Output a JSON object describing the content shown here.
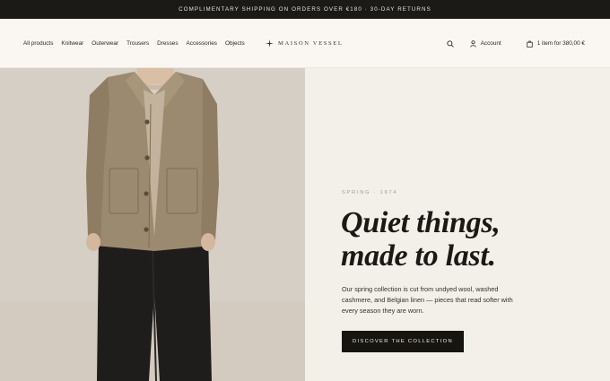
{
  "announcement": "COMPLIMENTARY SHIPPING ON ORDERS OVER €180 · 30-DAY RETURNS",
  "nav": [
    "All products",
    "Knitwear",
    "Outerwear",
    "Trousers",
    "Dresses",
    "Accessories",
    "Objects"
  ],
  "brand": "MAISON VESSEL",
  "header_tools": {
    "search_icon": "search-icon",
    "account_label": "Account",
    "cart_label": "1 item for 380,00 €"
  },
  "hero": {
    "eyebrow": "SPRING · 1974",
    "headline_line1": "Quiet things,",
    "headline_line2": "made to last.",
    "body": "Our spring collection is cut from undyed wool, washed cashmere, and Belgian linen — pieces that read softer with every season they are worn.",
    "cta_label": "DISCOVER THE COLLECTION"
  },
  "colors": {
    "announcement_bg": "#1c1a17",
    "header_bg": "#faf7f2",
    "page_bg": "#f3efe9",
    "cta_bg": "#17150f",
    "photo_bg": "#d6cfc5",
    "jacket": "#9c8a70",
    "trousers": "#1f1d1b"
  }
}
